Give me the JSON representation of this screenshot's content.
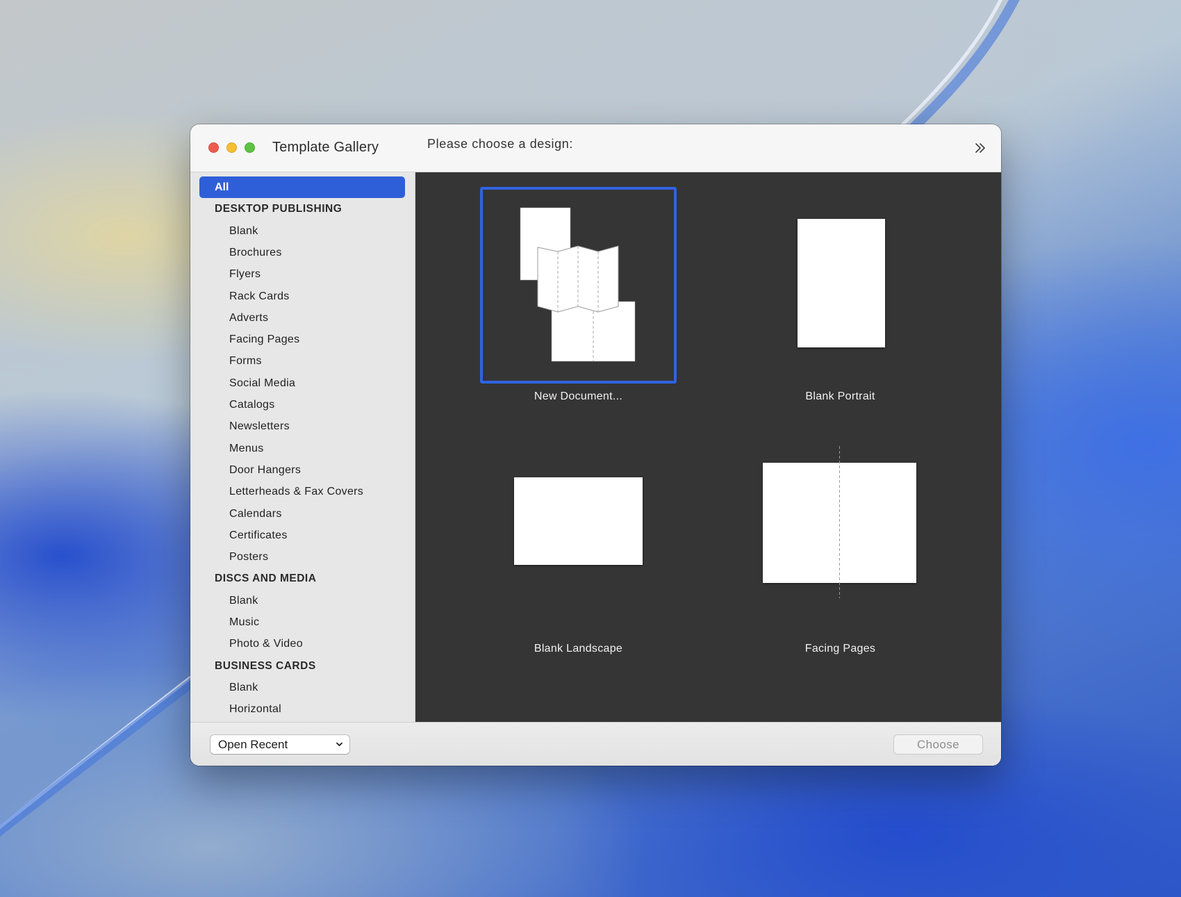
{
  "window": {
    "title": "Template Gallery",
    "prompt": "Please choose a design:"
  },
  "sidebar": {
    "items": [
      {
        "label": "All",
        "kind": "selected"
      },
      {
        "label": "DESKTOP PUBLISHING",
        "kind": "header"
      },
      {
        "label": "Blank",
        "kind": "item"
      },
      {
        "label": "Brochures",
        "kind": "item"
      },
      {
        "label": "Flyers",
        "kind": "item"
      },
      {
        "label": "Rack Cards",
        "kind": "item"
      },
      {
        "label": "Adverts",
        "kind": "item"
      },
      {
        "label": "Facing Pages",
        "kind": "item"
      },
      {
        "label": "Forms",
        "kind": "item"
      },
      {
        "label": "Social Media",
        "kind": "item"
      },
      {
        "label": "Catalogs",
        "kind": "item"
      },
      {
        "label": "Newsletters",
        "kind": "item"
      },
      {
        "label": "Menus",
        "kind": "item"
      },
      {
        "label": "Door Hangers",
        "kind": "item"
      },
      {
        "label": "Letterheads & Fax Covers",
        "kind": "item"
      },
      {
        "label": "Calendars",
        "kind": "item"
      },
      {
        "label": "Certificates",
        "kind": "item"
      },
      {
        "label": "Posters",
        "kind": "item"
      },
      {
        "label": "DISCS AND MEDIA",
        "kind": "header"
      },
      {
        "label": "Blank",
        "kind": "item"
      },
      {
        "label": "Music",
        "kind": "item"
      },
      {
        "label": "Photo & Video",
        "kind": "item"
      },
      {
        "label": "BUSINESS CARDS",
        "kind": "header"
      },
      {
        "label": "Blank",
        "kind": "item"
      },
      {
        "label": "Horizontal",
        "kind": "item"
      }
    ]
  },
  "gallery": {
    "tiles": [
      {
        "label": "New Document...",
        "selected": true
      },
      {
        "label": "Blank Portrait",
        "selected": false
      },
      {
        "label": "Blank Landscape",
        "selected": false
      },
      {
        "label": "Facing Pages",
        "selected": false
      }
    ]
  },
  "footer": {
    "open_recent_label": "Open Recent",
    "choose_label": "Choose"
  },
  "colors": {
    "accent": "#2f5fd8",
    "selection_border": "#2f63e2",
    "gallery_bg": "#353535",
    "close": "#ee5b50",
    "minimize": "#f5be34",
    "maximize": "#5fc246"
  },
  "icons": {
    "expand": "chevron-double-right-icon",
    "dropdown": "chevron-down-icon"
  }
}
